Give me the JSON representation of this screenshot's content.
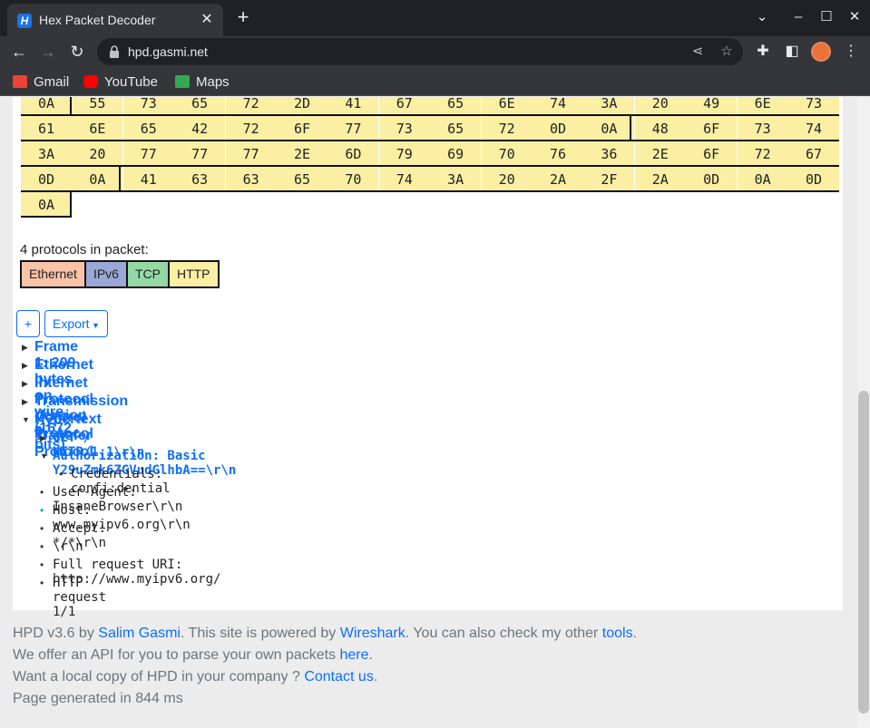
{
  "browser": {
    "tab_title": "Hex Packet Decoder",
    "tab_favicon": "H",
    "url": "hpd.gasmi.net",
    "bookmarks": [
      "Gmail",
      "YouTube",
      "Maps"
    ]
  },
  "hex": {
    "rows": [
      [
        "0A",
        "55",
        "73",
        "65",
        "72",
        "2D",
        "41",
        "67",
        "65",
        "6E",
        "74",
        "3A",
        "20",
        "49",
        "6E",
        "73"
      ],
      [
        "61",
        "6E",
        "65",
        "42",
        "72",
        "6F",
        "77",
        "73",
        "65",
        "72",
        "0D",
        "0A",
        "48",
        "6F",
        "73",
        "74"
      ],
      [
        "3A",
        "20",
        "77",
        "77",
        "77",
        "2E",
        "6D",
        "79",
        "69",
        "70",
        "76",
        "36",
        "2E",
        "6F",
        "72",
        "67"
      ],
      [
        "0D",
        "0A",
        "41",
        "63",
        "63",
        "65",
        "70",
        "74",
        "3A",
        "20",
        "2A",
        "2F",
        "2A",
        "0D",
        "0A",
        "0D"
      ],
      [
        "0A"
      ]
    ]
  },
  "protocols": {
    "count_label": "4 protocols in packet:",
    "items": [
      {
        "name": "Ethernet",
        "color": "#f9c3a8"
      },
      {
        "name": "IPv6",
        "color": "#9aa8d6"
      },
      {
        "name": "TCP",
        "color": "#94d9a4"
      },
      {
        "name": "HTTP",
        "color": "#fbefa3"
      }
    ]
  },
  "buttons": {
    "expand": "+",
    "export": "Export"
  },
  "tree": {
    "top": [
      {
        "label": "Frame 1: 209 bytes on wire (1672 bits)",
        "expanded": false
      },
      {
        "label": "Ethernet II",
        "expanded": false
      },
      {
        "label": "Internet Protocol Version 6",
        "expanded": false
      },
      {
        "label": "Transmission Control Protocol",
        "expanded": false
      },
      {
        "label": "Hypertext Transfer Protocol",
        "expanded": true
      }
    ],
    "http_fields": {
      "get": "GET / HTTP/1.1\\r\\n",
      "authorization": "Authorization: Basic Y29uZmk6ZGVudGlhbA==\\r\\n",
      "credentials": "Credentials: confi:dential",
      "user_agent": "User-Agent: InsaneBrowser\\r\\n",
      "host": "Host: www.myipv6.org\\r\\n",
      "accept": "Accept: */*\\r\\n",
      "crlf": "\\r\\n",
      "full_uri": "Full request URI: http://www.myipv6.org/",
      "request_num": "HTTP request 1/1"
    }
  },
  "footer": {
    "line1_a": "HPD v3.6 by ",
    "line1_author": "Salim Gasmi",
    "line1_b": ". This site is powered by ",
    "line1_wireshark": "Wireshark",
    "line1_c": ". You can also check my other ",
    "line1_tools": "tools",
    "line1_d": ".",
    "line2_a": "We offer an API for you to parse your own packets ",
    "line2_here": "here",
    "line2_b": ".",
    "line3_a": "Want a local copy of HPD in your company ? ",
    "line3_contact": "Contact us",
    "line3_b": ".",
    "line4": "Page generated in 844 ms"
  }
}
